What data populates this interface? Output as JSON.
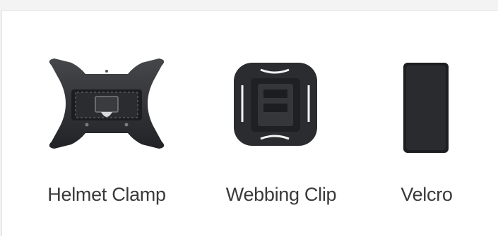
{
  "accessories": [
    {
      "label": "Helmet Clamp",
      "icon": "helmet-clamp-icon"
    },
    {
      "label": "Webbing Clip",
      "icon": "webbing-clip-icon"
    },
    {
      "label": "Velcro",
      "icon": "velcro-strap-icon"
    }
  ],
  "colors": {
    "panel_bg": "#ffffff",
    "page_bg": "#f3f3f3",
    "mount_body": "#2f3033",
    "label_text": "#3a3a3a"
  }
}
